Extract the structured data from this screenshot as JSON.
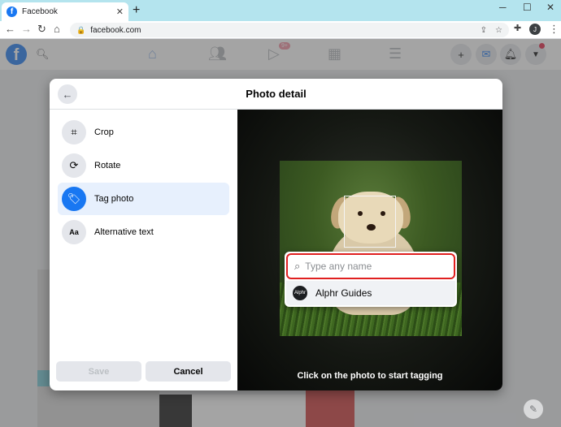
{
  "browser": {
    "tab_title": "Facebook",
    "tab_close": "✕",
    "new_tab": "+",
    "url": "facebook.com",
    "profile_initial": "J",
    "window_controls": [
      "─",
      "☐",
      "✕"
    ]
  },
  "fb_header": {
    "logo_letter": "f",
    "notification_badge": "9+"
  },
  "modal": {
    "title": "Photo detail",
    "side_items": [
      {
        "label": "Crop",
        "icon": "crop-icon",
        "glyph": "⌗"
      },
      {
        "label": "Rotate",
        "icon": "rotate-icon",
        "glyph": "⟳"
      },
      {
        "label": "Tag photo",
        "icon": "tag-icon",
        "glyph": "🏷"
      },
      {
        "label": "Alternative text",
        "icon": "alt-text-icon",
        "glyph": "Aa"
      }
    ],
    "active_item": "Tag photo",
    "save_label": "Save",
    "cancel_label": "Cancel",
    "tag_placeholder": "Type any name",
    "suggestion_name": "Alphr Guides",
    "suggestion_avatar_text": "Alphr",
    "hint": "Click on the photo to start tagging"
  },
  "colors": {
    "brand": "#1877f2",
    "highlight_border": "#e02020",
    "active_item_bg": "#e7f0fd"
  }
}
